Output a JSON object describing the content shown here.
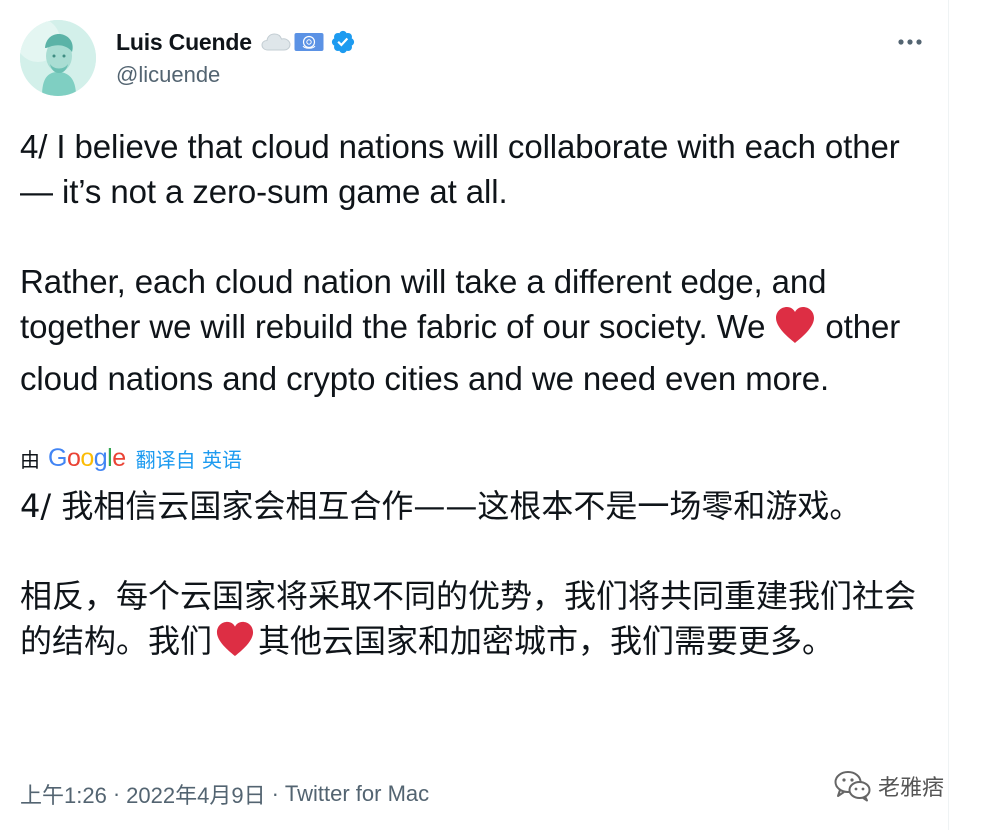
{
  "author": {
    "display_name": "Luis Cuende",
    "handle": "@licuende",
    "badges": [
      "cloud-emoji",
      "united-nations-flag-icon",
      "verified-badge-icon"
    ]
  },
  "menu": {
    "more_icon": "more-horizontal-icon"
  },
  "tweet": {
    "paragraph1": "4/ I believe that cloud nations will collaborate with each other — it’s not a zero-sum game at all.",
    "paragraph2_before_heart": "Rather, each cloud nation will take a different edge, and together we will rebuild the fabric of our society. We",
    "paragraph2_after_heart": "other cloud nations and crypto cities and we need even more.",
    "heart_icon": "red-heart-emoji"
  },
  "translation": {
    "by_label": "由",
    "provider": "Google",
    "link_label": "翻译自 英语",
    "paragraph1": "4/ 我相信云国家会相互合作——这根本不是一场零和游戏。",
    "paragraph2_before_heart": "相反，每个云国家将采取不同的优势，我们将共同重建我们社会的结构。我们",
    "paragraph2_after_heart": "其他云国家和加密城市，我们需要更多。"
  },
  "meta": {
    "time": "上午1:26",
    "separator": "·",
    "date": "2022年4月9日",
    "source": "Twitter for Mac"
  },
  "watermark": {
    "text": "老雅痞",
    "icon": "wechat-icon"
  },
  "colors": {
    "text_primary": "#0f1419",
    "text_secondary": "#536471",
    "link": "#1d9bf0",
    "verified": "#1d9bf0",
    "heart": "#dd2e44"
  }
}
